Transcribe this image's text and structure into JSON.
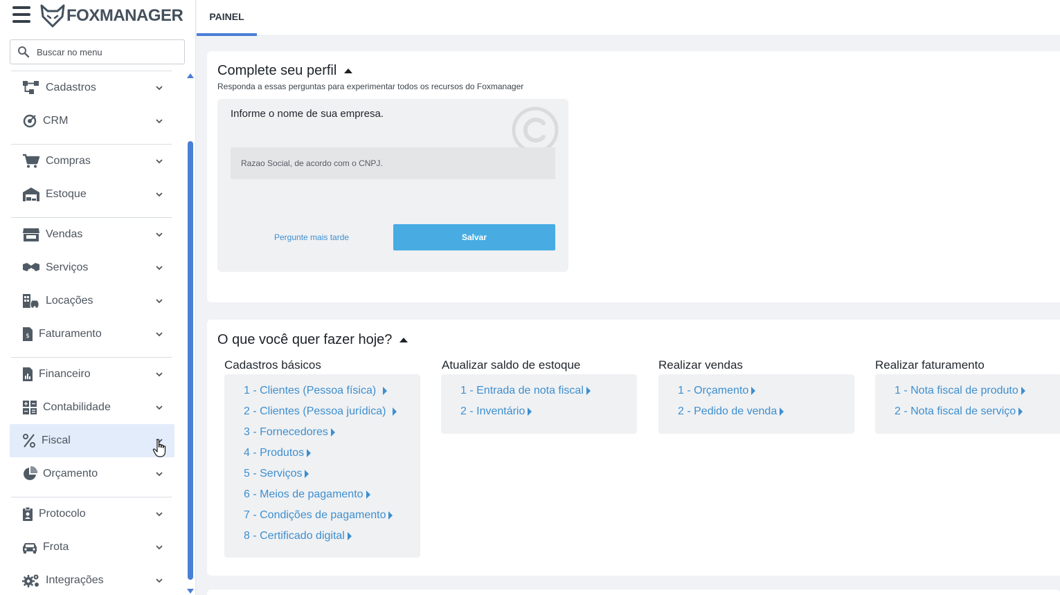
{
  "app": {
    "logo_text": "FOXMANAGER"
  },
  "search": {
    "placeholder": "Buscar no menu"
  },
  "menu": {
    "items": [
      {
        "label": "Cadastros",
        "icon": "hierarchy-icon"
      },
      {
        "label": "CRM",
        "icon": "target-icon"
      },
      {
        "label": "Compras",
        "icon": "cart-icon"
      },
      {
        "label": "Estoque",
        "icon": "warehouse-icon"
      },
      {
        "label": "Vendas",
        "icon": "store-icon"
      },
      {
        "label": "Serviços",
        "icon": "handshake-icon"
      },
      {
        "label": "Locações",
        "icon": "building-car-icon"
      },
      {
        "label": "Faturamento",
        "icon": "invoice-icon"
      },
      {
        "label": "Financeiro",
        "icon": "chart-document-icon"
      },
      {
        "label": "Contabilidade",
        "icon": "calculator-icon"
      },
      {
        "label": "Fiscal",
        "icon": "percent-icon"
      },
      {
        "label": "Orçamento",
        "icon": "pie-chart-icon"
      },
      {
        "label": "Protocolo",
        "icon": "clipboard-icon"
      },
      {
        "label": "Frota",
        "icon": "car-icon"
      },
      {
        "label": "Integrações",
        "icon": "gears-icon"
      }
    ]
  },
  "tabs": {
    "painel": "PAINEL"
  },
  "profile": {
    "title": "Complete seu perfil",
    "subtitle": "Responda a essas perguntas para experimentar todos os recursos do Foxmanager",
    "question": "Informe o nome de sua empresa.",
    "input_placeholder": "Razao Social, de acordo com o CNPJ.",
    "later_label": "Pergunte mais tarde",
    "save_label": "Salvar"
  },
  "today": {
    "title": "O que você quer fazer hoje?",
    "columns": [
      {
        "title": "Cadastros básicos",
        "links": [
          "1 - Clientes (Pessoa física)",
          "2 - Clientes (Pessoa jurídica)",
          "3 - Fornecedores",
          "4 - Produtos",
          "5 - Serviços",
          "6 - Meios de pagamento",
          "7 - Condições de pagamento",
          "8 - Certificado digital"
        ]
      },
      {
        "title": "Atualizar saldo de estoque",
        "links": [
          "1 - Entrada de nota fiscal",
          "2 - Inventário"
        ]
      },
      {
        "title": "Realizar vendas",
        "links": [
          "1 - Orçamento",
          "2 - Pedido de venda"
        ]
      },
      {
        "title": "Realizar faturamento",
        "links": [
          "1 - Nota fiscal de produto",
          "2 - Nota fiscal de serviço"
        ]
      }
    ]
  },
  "colors": {
    "accent": "#4a7fd6",
    "link": "#3d8fcf",
    "save_button": "#48ace3",
    "active_menu": "#e3ecfa"
  }
}
